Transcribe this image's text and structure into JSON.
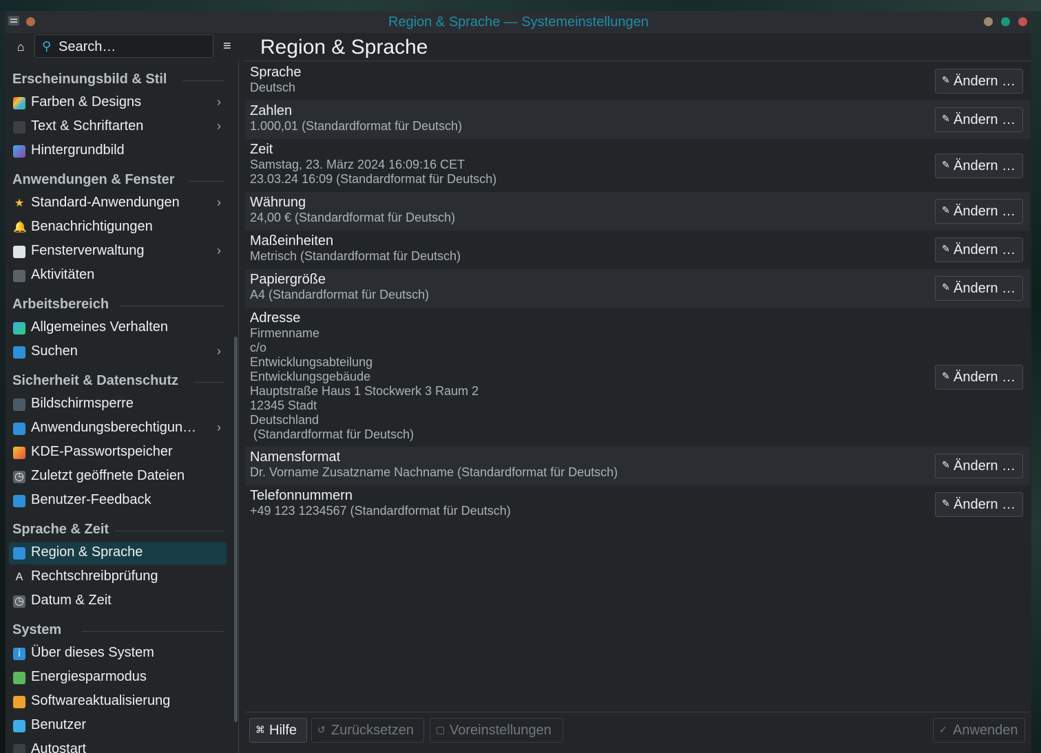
{
  "window": {
    "title": "Region & Sprache — Systemeinstellungen"
  },
  "sidebar": {
    "search_placeholder": "Search…",
    "categories": [
      {
        "label": "Erscheinungsbild & Stil"
      },
      {
        "label": "Anwendungen & Fenster"
      },
      {
        "label": "Arbeitsbereich"
      },
      {
        "label": "Sicherheit & Datenschutz"
      },
      {
        "label": "Sprache & Zeit"
      },
      {
        "label": "System"
      }
    ],
    "items": [
      {
        "label": "Farben & Designs",
        "icon": "colors-icon",
        "has_children": true
      },
      {
        "label": "Text & Schriftarten",
        "icon": "fonts-icon",
        "has_children": true
      },
      {
        "label": "Hintergrundbild",
        "icon": "wallpaper-icon",
        "has_children": false
      },
      {
        "label": "Standard-Anwendungen",
        "icon": "star-icon",
        "has_children": true
      },
      {
        "label": "Benachrichtigungen",
        "icon": "bell-icon",
        "has_children": false
      },
      {
        "label": "Fensterverwaltung",
        "icon": "window-icon",
        "has_children": true
      },
      {
        "label": "Aktivitäten",
        "icon": "activities-icon",
        "has_children": false
      },
      {
        "label": "Allgemeines Verhalten",
        "icon": "behavior-icon",
        "has_children": false
      },
      {
        "label": "Suchen",
        "icon": "search-icon",
        "has_children": true
      },
      {
        "label": "Bildschirmsperre",
        "icon": "lock-screen-icon",
        "has_children": false
      },
      {
        "label": "Anwendungsberechtigun…",
        "icon": "shield-icon",
        "has_children": true
      },
      {
        "label": "KDE-Passwortspeicher",
        "icon": "wallet-icon",
        "has_children": false
      },
      {
        "label": "Zuletzt geöffnete Dateien",
        "icon": "clock-icon",
        "has_children": false
      },
      {
        "label": "Benutzer-Feedback",
        "icon": "feedback-icon",
        "has_children": false
      },
      {
        "label": "Region & Sprache",
        "icon": "region-icon",
        "has_children": false,
        "selected": true
      },
      {
        "label": "Rechtschreibprüfung",
        "icon": "spellcheck-icon",
        "has_children": false
      },
      {
        "label": "Datum & Zeit",
        "icon": "clock-icon",
        "has_children": false
      },
      {
        "label": "Über dieses System",
        "icon": "info-icon",
        "has_children": false
      },
      {
        "label": "Energiesparmodus",
        "icon": "power-icon",
        "has_children": false
      },
      {
        "label": "Softwareaktualisierung",
        "icon": "update-icon",
        "has_children": false
      },
      {
        "label": "Benutzer",
        "icon": "user-icon",
        "has_children": false
      },
      {
        "label": "Autostart",
        "icon": "autostart-icon",
        "has_children": false
      }
    ]
  },
  "main": {
    "title": "Region & Sprache",
    "change_label": "Ändern …",
    "rows": [
      {
        "title": "Sprache",
        "value": "Deutsch"
      },
      {
        "title": "Zahlen",
        "value": "1.000,01 (Standardformat für Deutsch)"
      },
      {
        "title": "Zeit",
        "value": "Samstag, 23. März 2024 16:09:16 CET\n23.03.24 16:09 (Standardformat für Deutsch)"
      },
      {
        "title": "Währung",
        "value": "24,00 € (Standardformat für Deutsch)"
      },
      {
        "title": "Maßeinheiten",
        "value": "Metrisch (Standardformat für Deutsch)"
      },
      {
        "title": "Papiergröße",
        "value": "A4 (Standardformat für Deutsch)"
      },
      {
        "title": "Adresse",
        "value": "Firmenname\nc/o\nEntwicklungsabteilung\nEntwicklungsgebäude\nHauptstraße Haus 1 Stockwerk 3 Raum 2\n12345 Stadt\nDeutschland\n (Standardformat für Deutsch)"
      },
      {
        "title": "Namensformat",
        "value": "Dr. Vorname Zusatzname Nachname (Standardformat für Deutsch)"
      },
      {
        "title": "Telefonnummern",
        "value": "+49 123 1234567 (Standardformat für Deutsch)"
      }
    ]
  },
  "footer": {
    "help": "Hilfe",
    "reset": "Zurücksetzen",
    "defaults": "Voreinstellungen",
    "apply": "Anwenden"
  },
  "colors": {
    "accent": "#1f8ea6",
    "selection": "#183d47",
    "window_bg": "#232629"
  }
}
